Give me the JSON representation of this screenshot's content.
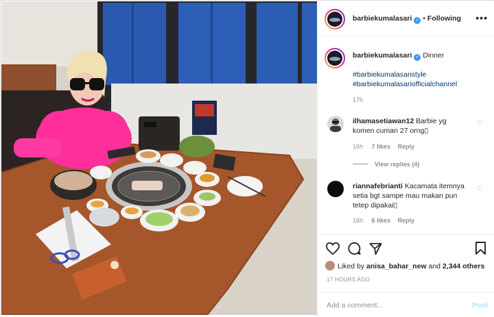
{
  "header": {
    "username": "barbiekumalasari",
    "follow_state": "Following",
    "dot": "•",
    "more": "•••",
    "verified_glyph": "✓"
  },
  "caption": {
    "username": "barbiekumalasari",
    "text": "Dinner",
    "hashtags": [
      "#barbiekumalasaristyle",
      "#barbiekumalasariofficialchannel"
    ],
    "age": "17h"
  },
  "comments": [
    {
      "username": "ilhamasetiawan12",
      "text_line1": "Barbie yg",
      "text_line2": "komen cuman 27 orng\u0000",
      "text_display_line2": "komen cuman 27 orng▯",
      "age": "16h",
      "likes": "7 likes",
      "reply": "Reply"
    },
    {
      "username": "riannafebrianti",
      "text_line1": "Kacamata itemnya",
      "text_line2": "setia bgt sampe mau makan pun",
      "text_line3": "tetep dipakai▯",
      "age": "16h",
      "likes": "6 likes",
      "reply": "Reply"
    }
  ],
  "view_replies": "View replies (4)",
  "actions": {
    "liked_by_prefix": "Liked by",
    "liked_by_user": "anisa_bahar_new",
    "liked_by_and": "and",
    "others": "2,344 others",
    "timestamp": "17 HOURS AGO"
  },
  "add_comment": {
    "placeholder": "Add a comment...",
    "post_label": "Post"
  },
  "colors": {
    "link": "#003569",
    "verified": "#3897f0",
    "muted": "#8e8e8e",
    "post_disabled": "#b2dffc"
  },
  "icons": [
    "heart-icon",
    "comment-icon",
    "share-icon",
    "bookmark-icon",
    "more-icon"
  ]
}
